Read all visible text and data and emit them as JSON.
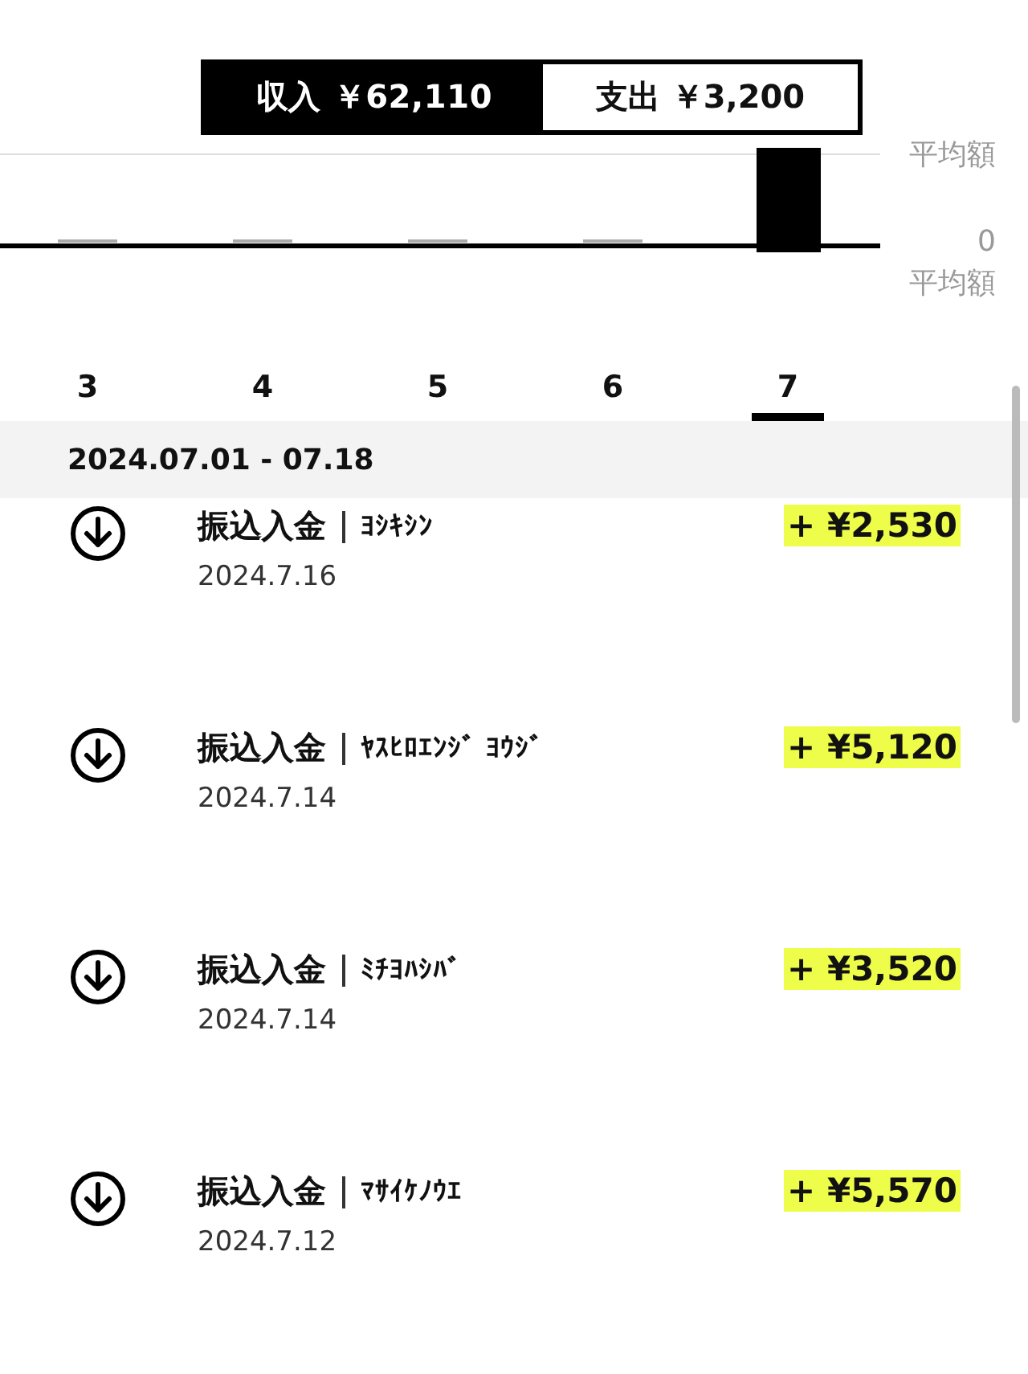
{
  "summary": {
    "income": "収入 ￥62,110",
    "expense": "支出 ￥3,200"
  },
  "chart": {
    "axis_labels": [
      "平均額",
      "0",
      "平均額"
    ]
  },
  "months": [
    {
      "label": "3",
      "selected": false
    },
    {
      "label": "4",
      "selected": false
    },
    {
      "label": "5",
      "selected": false
    },
    {
      "label": "6",
      "selected": false
    },
    {
      "label": "7",
      "selected": true
    }
  ],
  "period": "2024.07.01 - 07.18",
  "transactions": [
    {
      "type": "振込入金",
      "name": "ﾖｼｷｼﾝ",
      "date": "2024.7.16",
      "amount": "+ ¥2,530"
    },
    {
      "type": "振込入金",
      "name": "ﾔｽﾋﾛｴﾝｼﾞ ﾖｳｼﾞ",
      "date": "2024.7.14",
      "amount": "+ ¥5,120"
    },
    {
      "type": "振込入金",
      "name": "ﾐﾁﾖﾊｼﾊﾞ",
      "date": "2024.7.14",
      "amount": "+ ¥3,520"
    },
    {
      "type": "振込入金",
      "name": "ﾏｻｲｹﾉｳｴ",
      "date": "2024.7.12",
      "amount": "+ ¥5,570"
    }
  ]
}
